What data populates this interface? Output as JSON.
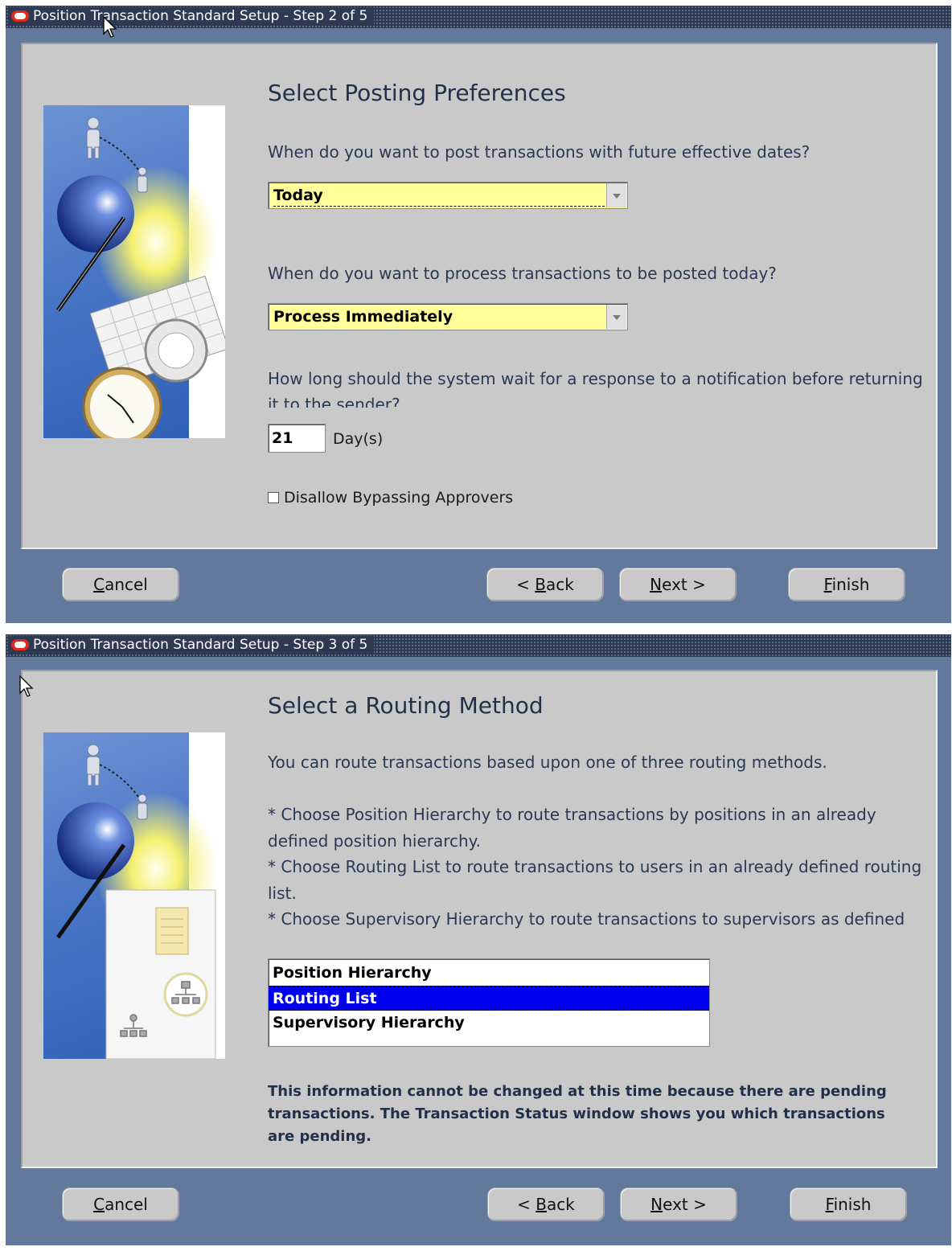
{
  "windows": [
    {
      "title": "Position Transaction Standard Setup - Step 2 of 5",
      "heading": "Select Posting Preferences",
      "questions": [
        "When do you want to post transactions with future effective dates?",
        "When do you want to process transactions to be posted today?",
        "How long should the system wait for a response to a notification before returning it to the sender?"
      ],
      "post_future_select": "Today",
      "process_today_select": "Process Immediately",
      "wait_days_value": "21",
      "wait_days_unit": "Day(s)",
      "disallow_bypass_label": "Disallow Bypassing Approvers",
      "disallow_bypass_checked": false,
      "buttons": {
        "cancel": "Cancel",
        "back": "< Back",
        "next": "Next >",
        "finish": "Finish"
      }
    },
    {
      "title": "Position Transaction Standard Setup - Step 3 of 5",
      "heading": "Select a Routing Method",
      "intro": "You can route transactions based upon one of three routing methods.",
      "bullets": [
        "*  Choose Position Hierarchy to route transactions by positions in an already defined position hierarchy.",
        "*  Choose Routing List to route transactions to users in an already defined routing list.",
        "*  Choose Supervisory Hierarchy to route transactions to supervisors as defined"
      ],
      "routing_options": [
        "Position Hierarchy",
        "Routing List",
        "Supervisory Hierarchy"
      ],
      "routing_selected": "Routing List",
      "warning": "This information cannot be changed at this time because there are pending transactions. The Transaction Status window shows you which transactions are pending.",
      "buttons": {
        "cancel": "Cancel",
        "back": "< Back",
        "next": "Next >",
        "finish": "Finish"
      }
    }
  ],
  "colors": {
    "frame": "#62799b",
    "panel": "#c9c9c9",
    "titlebar": "#2e3a52",
    "field_highlight": "#ffff9c",
    "list_selected": "#0000ef",
    "oracle_logo": "#e6261a"
  }
}
